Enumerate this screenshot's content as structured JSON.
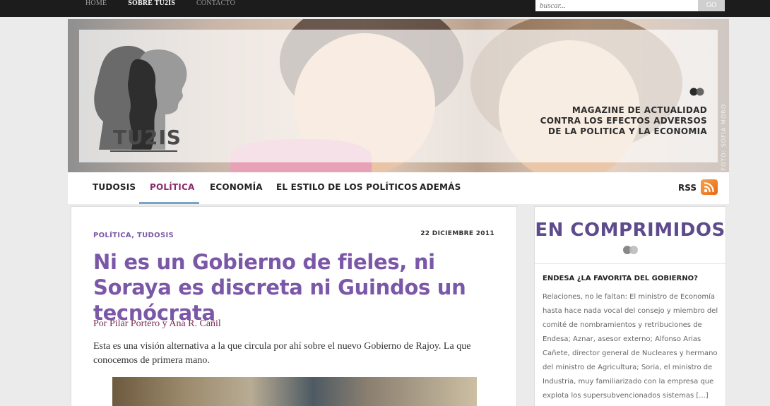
{
  "topbar": {
    "nav": [
      "HOME",
      "SOBRE TU2IS",
      "CONTACTO"
    ],
    "search_placeholder": "buscar...",
    "go_label": "GO"
  },
  "banner": {
    "logo_text": "TU2IS",
    "tagline": [
      "MAGAZINE DE ACTUALIDAD",
      "CONTRA LOS EFECTOS ADVERSOS",
      "DE LA POLITICA Y LA ECONOMIA"
    ],
    "photo_credit": "FOTO: SOFIA MORO"
  },
  "mainnav": {
    "items": [
      "TUDOSIS",
      "POLÍTICA",
      "ECONOMÍA",
      "EL ESTILO DE LOS POLÍTICOS",
      "ADEMÁS"
    ],
    "active": "POLÍTICA",
    "rss_label": "RSS"
  },
  "article": {
    "categories": "POLÍTICA, TUDOSIS",
    "date": "22 DICIEMBRE 2011",
    "title": "Ni es un Gobierno de fieles, ni Soraya es discreta ni Guindos un tecnócrata",
    "byline": "Por Pilar Portero y Ana R. Cañil",
    "lede": "Esta es una visión alternativa a la que circula por ahí sobre el nuevo Gobierno de Rajoy. La que conocemos de primera mano."
  },
  "sidebar": {
    "title": "EN COMPRIMIDOS",
    "item_title": "ENDESA ¿LA FAVORITA DEL GOBIERNO?",
    "item_text": "Relaciones, no le faltan: El ministro de Economía hasta hace nada vocal del consejo y miembro del comité de nombramientos y retribuciones de Endesa; Aznar, asesor externo; Alfonso Arias Cañete, director general de Nucleares y hermano del ministro de Agricultura; Soria, el ministro de Industria, muy familiarizado con la empresa que explota los supersubvencionados sistemas [...]"
  },
  "colors": {
    "accent_purple": "#7b57a8",
    "nav_active": "#8b2a6a",
    "byline": "#7a2a55",
    "rss_orange": "#e86a12"
  }
}
